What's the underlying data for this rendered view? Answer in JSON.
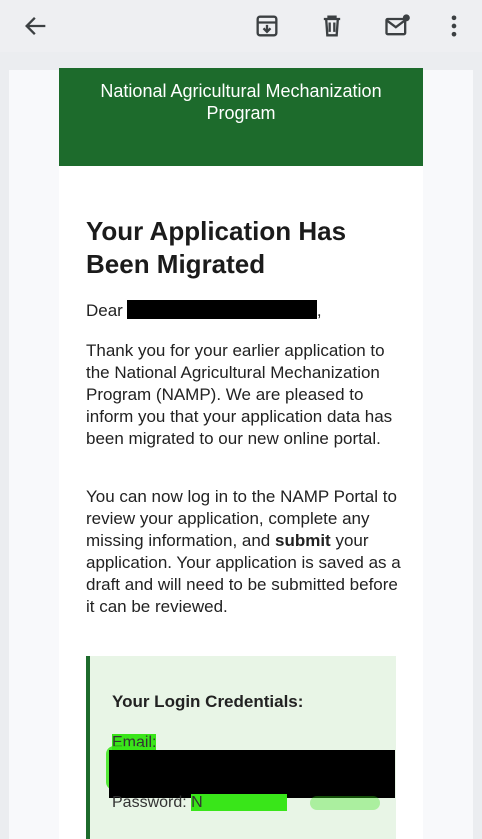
{
  "toolbar": {
    "back": "arrow-left-icon",
    "archive": "archive-icon",
    "delete": "trash-icon",
    "mark_unread": "mail-unread-icon",
    "more": "more-vert-icon"
  },
  "email": {
    "header": "National Agricultural Mechanization Program",
    "title": "Your Application Has Been Migrated",
    "salutation_prefix": "Dear",
    "salutation_suffix": ",",
    "paragraph1": "Thank you for your earlier application to the National Agricultural Mechanization Program (NAMP). We are pleased to inform you that your application data has been migrated to our new online portal.",
    "paragraph2_a": "You can now log in to the NAMP Portal to review your application, complete any missing information, and ",
    "paragraph2_bold": "submit",
    "paragraph2_b": " your application. Your application is saved as a draft and will need to be submitted before it can be reviewed.",
    "credentials": {
      "title": "Your Login Credentials:",
      "email_label": "Email:",
      "password_label": "Password:",
      "password_visible": "N"
    }
  },
  "colors": {
    "header_bg": "#1d6b2c",
    "credentials_bg": "#e8f5e6",
    "highlight": "#39e619"
  }
}
